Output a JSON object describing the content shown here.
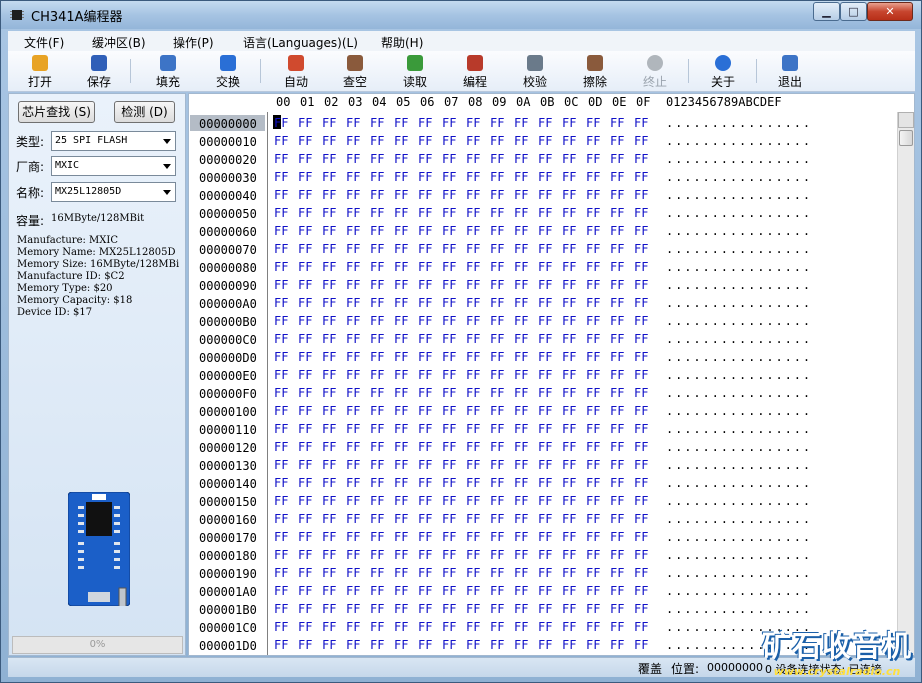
{
  "window": {
    "title": "CH341A编程器"
  },
  "menu": [
    "文件(F)",
    "缓冲区(B)",
    "操作(P)",
    "语言(Languages)(L)",
    "帮助(H)"
  ],
  "toolbar": [
    {
      "label": "打开",
      "icon": "open-folder-icon",
      "color": "#e8a325"
    },
    {
      "label": "保存",
      "icon": "save-disk-icon",
      "color": "#2f5fb8"
    },
    {
      "label": "填充",
      "icon": "fill-pencil-icon",
      "color": "#3d74c6"
    },
    {
      "label": "交换",
      "icon": "swap-arrows-icon",
      "color": "#2a6fd6"
    },
    {
      "label": "自动",
      "icon": "auto-chip-icon",
      "color": "#d04a2e"
    },
    {
      "label": "查空",
      "icon": "blank-check-chip-icon",
      "color": "#8a5a3c"
    },
    {
      "label": "读取",
      "icon": "read-chip-icon",
      "color": "#3a9a3a"
    },
    {
      "label": "编程",
      "icon": "program-chip-icon",
      "color": "#b83a2a"
    },
    {
      "label": "校验",
      "icon": "verify-icon",
      "color": "#6a7a8a"
    },
    {
      "label": "擦除",
      "icon": "erase-chip-icon",
      "color": "#8a5a3c"
    },
    {
      "label": "终止",
      "icon": "stop-icon",
      "color": "#b0b6bc"
    },
    {
      "label": "关于",
      "icon": "info-icon",
      "color": "#2a6fd6"
    },
    {
      "label": "退出",
      "icon": "exit-door-icon",
      "color": "#3d74c6"
    }
  ],
  "left": {
    "find_chip_button": "芯片查找 (S)",
    "detect_button": "检测 (D)",
    "type_label": "类型:",
    "type_value": "25 SPI FLASH",
    "vendor_label": "厂商:",
    "vendor_value": "MXIC",
    "name_label": "名称:",
    "name_value": "MX25L12805D",
    "capacity_label": "容量:",
    "capacity_value": "16MByte/128MBit",
    "info_lines": [
      "Manufacture: MXIC",
      "Memory Name: MX25L12805D",
      "Memory Size: 16MByte/128MBi",
      "Manufacture ID: $C2",
      "Memory Type: $20",
      "Memory Capacity: $18",
      "Device ID: $17"
    ],
    "progress_text": "0%",
    "progress_value": 0
  },
  "hex": {
    "columns": [
      "00",
      "01",
      "02",
      "03",
      "04",
      "05",
      "06",
      "07",
      "08",
      "09",
      "0A",
      "0B",
      "0C",
      "0D",
      "0E",
      "0F"
    ],
    "ascii_header": "0123456789ABCDEF",
    "rows": [
      "00000000",
      "00000010",
      "00000020",
      "00000030",
      "00000040",
      "00000050",
      "00000060",
      "00000070",
      "00000080",
      "00000090",
      "000000A0",
      "000000B0",
      "000000C0",
      "000000D0",
      "000000E0",
      "000000F0",
      "00000100",
      "00000110",
      "00000120",
      "00000130",
      "00000140",
      "00000150",
      "00000160",
      "00000170",
      "00000180",
      "00000190",
      "000001A0",
      "000001B0",
      "000001C0",
      "000001D0"
    ],
    "byte_value": "FF",
    "ascii_row": "................"
  },
  "status": {
    "mode": "覆盖",
    "position_label": "位置:",
    "position_value": "00000000",
    "extra": "0  设备连接状态: 已连接"
  },
  "watermark": {
    "cn": "矿石收音机",
    "en": "www.crystalradio.cn"
  }
}
